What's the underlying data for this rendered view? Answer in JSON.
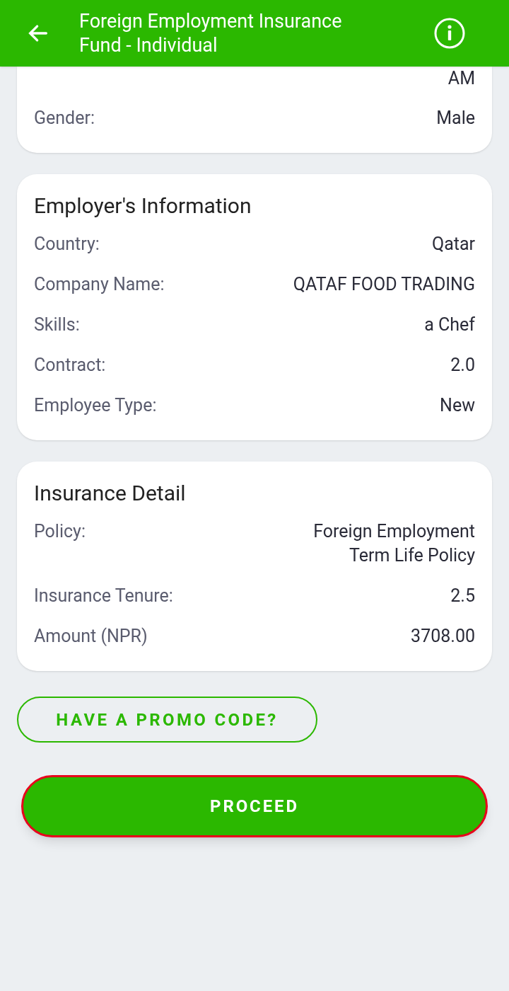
{
  "header": {
    "title": "Foreign Employment Insurance Fund - Individual"
  },
  "sections": [
    {
      "rows": [
        {
          "value": "AM"
        },
        {
          "label": "Gender:",
          "value": "Male"
        }
      ]
    },
    {
      "title": "Employer's Information",
      "rows": [
        {
          "label": "Country:",
          "value": "Qatar"
        },
        {
          "label": "Company Name:",
          "value": "QATAF FOOD TRADING"
        },
        {
          "label": "Skills:",
          "value": "a Chef"
        },
        {
          "label": "Contract:",
          "value": "2.0"
        },
        {
          "label": "Employee Type:",
          "value": "New"
        }
      ]
    },
    {
      "title": "Insurance Detail",
      "rows": [
        {
          "label": "Policy:",
          "value": "Foreign Employment Term Life Policy"
        },
        {
          "label": "Insurance Tenure:",
          "value": "2.5"
        },
        {
          "label": "Amount (NPR)",
          "value": "3708.00"
        }
      ]
    }
  ],
  "promo_button": "HAVE A PROMO CODE?",
  "proceed_button": "PROCEED"
}
